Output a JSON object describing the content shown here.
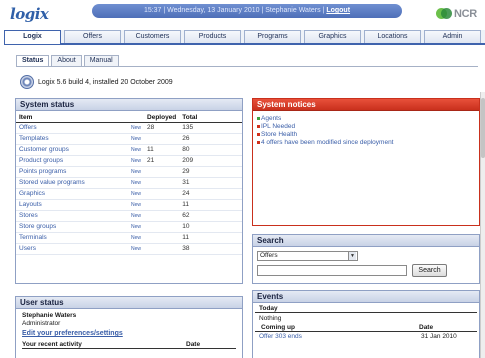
{
  "header": {
    "logo": "logix",
    "status_text": "15:37 | Wednesday, 13 January 2010 | Stephanie Waters | ",
    "logout_label": "Logout",
    "brand": "NCR"
  },
  "tabs": [
    "Logix",
    "Offers",
    "Customers",
    "Products",
    "Programs",
    "Graphics",
    "Locations",
    "Admin"
  ],
  "subtabs": [
    "Status",
    "About",
    "Manual"
  ],
  "version": "Logix 5.6 build 4, installed 20 October 2009",
  "system_status": {
    "title": "System status",
    "headers": {
      "item": "Item",
      "deployed": "Deployed",
      "total": "Total"
    },
    "new_label": "New",
    "rows": [
      {
        "item": "Offers",
        "deployed": "28",
        "total": "135"
      },
      {
        "item": "Templates",
        "deployed": "",
        "total": "26"
      },
      {
        "item": "Customer groups",
        "deployed": "11",
        "total": "80"
      },
      {
        "item": "Product groups",
        "deployed": "21",
        "total": "209"
      },
      {
        "item": "Points programs",
        "deployed": "",
        "total": "29"
      },
      {
        "item": "Stored value programs",
        "deployed": "",
        "total": "31"
      },
      {
        "item": "Graphics",
        "deployed": "",
        "total": "24"
      },
      {
        "item": "Layouts",
        "deployed": "",
        "total": "11"
      },
      {
        "item": "Stores",
        "deployed": "",
        "total": "62"
      },
      {
        "item": "Store groups",
        "deployed": "",
        "total": "10"
      },
      {
        "item": "Terminals",
        "deployed": "",
        "total": "11"
      },
      {
        "item": "Users",
        "deployed": "",
        "total": "38"
      }
    ]
  },
  "system_notices": {
    "title": "System notices",
    "items": [
      {
        "text": "Agents",
        "color": "#3aa540"
      },
      {
        "text": "IPL Needed",
        "color": "#d0301c"
      },
      {
        "text": "Store Health",
        "color": "#d0301c"
      },
      {
        "text": "4 offers have been modified since deployment",
        "color": "#d0301c"
      }
    ]
  },
  "search": {
    "title": "Search",
    "selected": "Offers",
    "button": "Search"
  },
  "events": {
    "title": "Events",
    "today_label": "Today",
    "today_value": "Nothing",
    "coming_label": "Coming up",
    "date_label": "Date",
    "rows": [
      {
        "event": "Offer 303 ends",
        "date": "31 Jan 2010"
      }
    ]
  },
  "user_status": {
    "title": "User status",
    "name": "Stephanie Waters",
    "role": "Administrator",
    "edit_link": "Edit your preferences/settings",
    "activity_label": "Your recent activity",
    "date_label": "Date"
  }
}
